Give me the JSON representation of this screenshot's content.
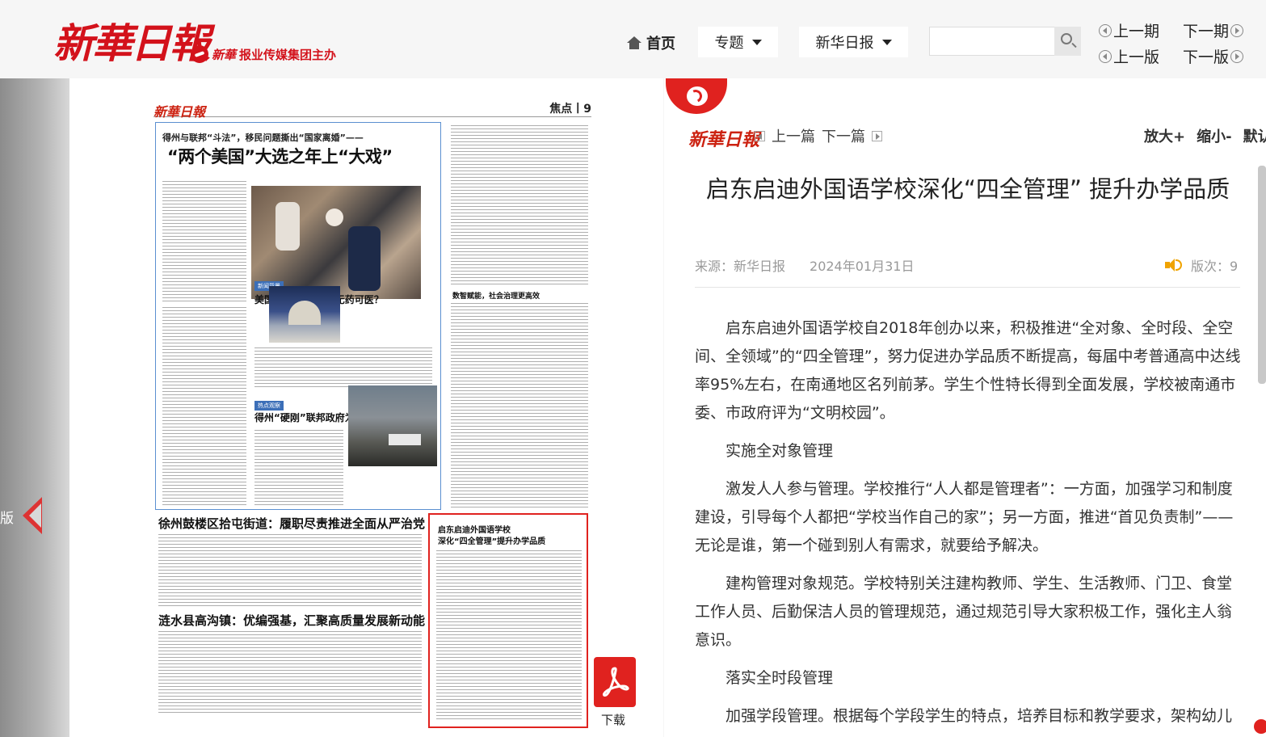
{
  "header": {
    "logo_text": "新華日報",
    "sub_brand": "新華",
    "sub_text": "报业传媒集团主办",
    "nav": {
      "home": "首页",
      "topics": "专题",
      "xinhua_daily": "新华日报"
    },
    "search": {
      "placeholder": ""
    },
    "period": {
      "prev_issue": "上一期",
      "next_issue": "下一期",
      "prev_page": "上一版",
      "next_page": "下一版"
    }
  },
  "left_edge": {
    "label": "版"
  },
  "newspaper": {
    "logo": "新華日報",
    "section": "焦点丨9",
    "kicker": "得州与联邦“斗法”，移民问题撕出“国家离婚”——",
    "headline": "“两个美国”大选之年上“大戏”",
    "tag1": "新闻背景",
    "subhead1": "美国“选举综合征”无药可医？",
    "tag2": "热点观察",
    "subhead2": "得州“硬刚”联邦政府为哪般？",
    "subhead3": "数智赋能，社会治理更高效",
    "headline2": "徐州鼓楼区拾屯街道：履职尽责推进全面从严治党",
    "headline3": "涟水县高沟镇：优编强基，汇聚高质量发展新动能",
    "highlight_line1": "启东启迪外国语学校",
    "highlight_line2": "深化“四全管理”提升办学品质"
  },
  "download": {
    "label": "下载",
    "icon": "pdf-icon"
  },
  "article": {
    "logo": "新華日報",
    "prev": "上一篇",
    "next": "下一篇",
    "zoom_in": "放大+",
    "zoom_out": "缩小-",
    "default": "默认",
    "title": "启东启迪外国语学校深化“四全管理” 提升办学品质",
    "source": "来源：新华日报",
    "date": "2024年01月31日",
    "page": "版次：9",
    "paragraphs": [
      "启东启迪外国语学校自2018年创办以来，积极推进“全对象、全时段、全空间、全领域”的“四全管理”，努力促进办学品质不断提高，每届中考普通高中达线率95%左右，在南通地区名列前茅。学生个性特长得到全面发展，学校被南通市委、市政府评为“文明校园”。",
      "实施全对象管理",
      "激发人人参与管理。学校推行“人人都是管理者”：一方面，加强学习和制度建设，引导每个人都把“学校当作自己的家”；另一方面，推进“首见负责制”——无论是谁，第一个碰到别人有需求，就要给予解决。",
      "建构管理对象规范。学校特别关注建构教师、学生、生活教师、门卫、食堂工作人员、后勤保洁人员的管理规范，通过规范引导大家积极工作，强化主人翁意识。",
      "落实全时段管理",
      "加强学段管理。根据每个学段学生的特点，培养目标和教学要求，架构幼儿"
    ]
  },
  "colors": {
    "accent": "#e0221f",
    "brand": "#d3121b"
  }
}
